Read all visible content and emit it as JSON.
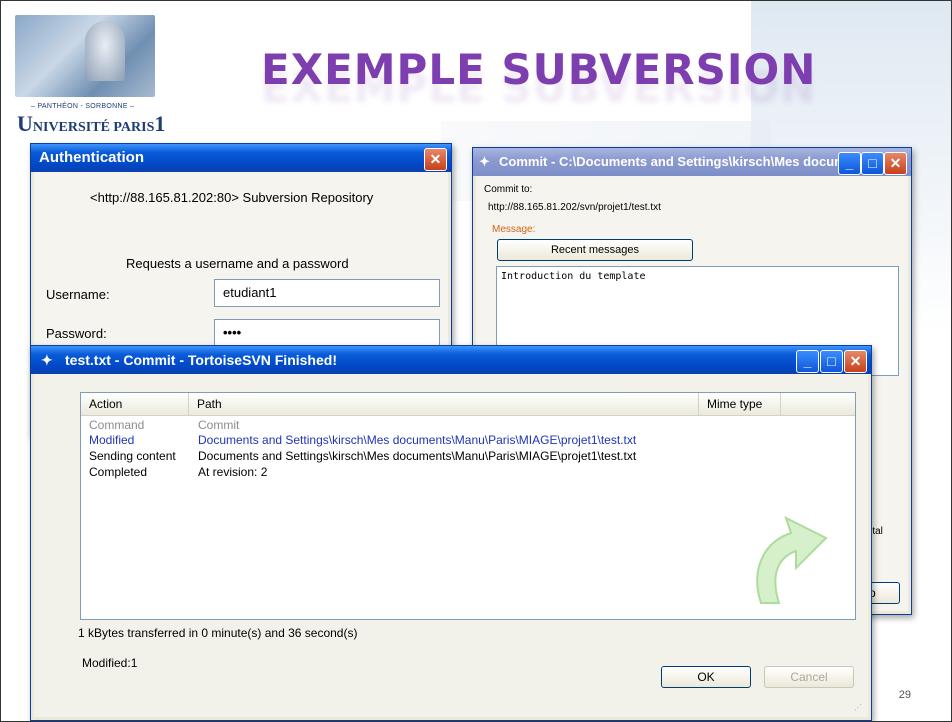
{
  "slide": {
    "title": "EXEMPLE SUBVERSION",
    "page_number": "29",
    "logo": {
      "small": "– PANTHÉON - SORBONNE –",
      "main": "NIVERSITÉ PARIS",
      "initial": "U",
      "number": "1"
    }
  },
  "auth_dialog": {
    "title": "Authentication",
    "realm": "<http://88.165.81.202:80> Subversion Repository",
    "prompt": "Requests a username and a password",
    "username_label": "Username:",
    "username_value": "etudiant1",
    "password_label": "Password:",
    "password_value": "••••"
  },
  "commit_dialog": {
    "title": "Commit - C:\\Documents and Settings\\kirsch\\Mes docum...",
    "commit_to_label": "Commit to:",
    "commit_to_url": "http://88.165.81.202/svn/projet1/test.txt",
    "message_label": "Message:",
    "recent_button": "Recent messages",
    "message_text": "Introduction du template",
    "total_fragment": "total",
    "button_fragment": "p"
  },
  "finished_dialog": {
    "title": "test.txt - Commit - TortoiseSVN Finished!",
    "columns": [
      "Action",
      "Path",
      "Mime type"
    ],
    "rows": [
      {
        "action": "Command",
        "path": "Commit",
        "style": "cmd"
      },
      {
        "action": "Modified",
        "path": "Documents and Settings\\kirsch\\Mes documents\\Manu\\Paris\\MIAGE\\projet1\\test.txt",
        "style": "mod"
      },
      {
        "action": "Sending content",
        "path": "Documents and Settings\\kirsch\\Mes documents\\Manu\\Paris\\MIAGE\\projet1\\test.txt",
        "style": "norm"
      },
      {
        "action": "Completed",
        "path": "At revision: 2",
        "style": "norm"
      }
    ],
    "transfer_status": "1 kBytes transferred in 0 minute(s) and 36 second(s)",
    "summary": "Modified:1",
    "ok_button": "OK",
    "cancel_button": "Cancel"
  },
  "colors": {
    "title_purple": "#7d3fb0",
    "xp_blue": "#0149c8",
    "modified_blue": "#1f35b5"
  }
}
